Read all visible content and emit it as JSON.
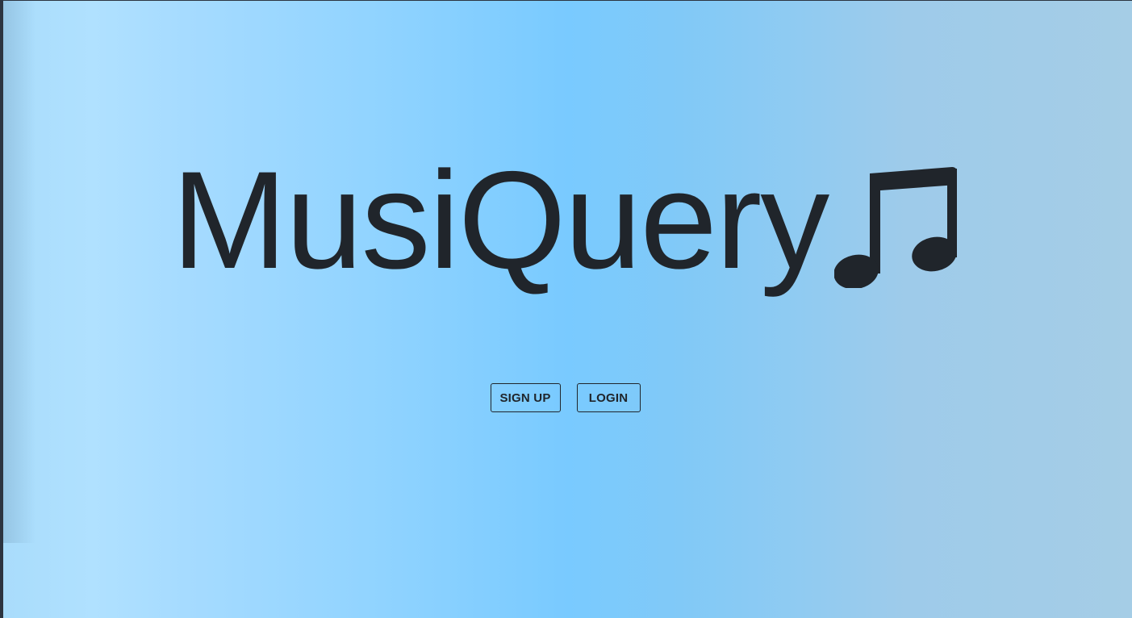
{
  "brand": {
    "title": "MusiQuery",
    "icon": "music-note-icon"
  },
  "actions": {
    "signup_label": "SIGN UP",
    "login_label": "LOGIN"
  },
  "colors": {
    "text": "#20252b",
    "gradient_left": "#b0e1ff",
    "gradient_center": "#79caff",
    "gradient_right": "#a5cde6"
  }
}
